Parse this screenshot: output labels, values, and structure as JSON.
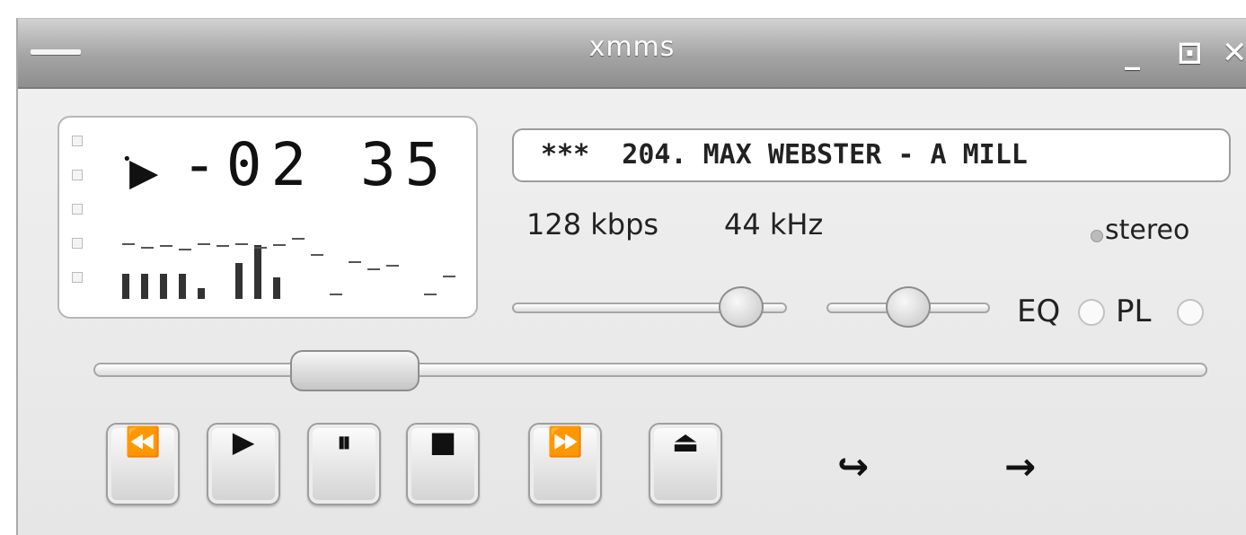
{
  "window": {
    "title": "xmms",
    "min_glyph": "_",
    "max_glyph": "⊡",
    "close_glyph": "✕"
  },
  "display": {
    "play_indicator": "▶",
    "play_dot": "•",
    "time": "-02 35",
    "status_squares": 5
  },
  "song": {
    "marquee": "***  204. MAX WEBSTER - A MILL"
  },
  "info": {
    "bitrate": "128 kbps",
    "samplerate": "44 kHz",
    "channel": "stereo"
  },
  "toggles": {
    "eq": "EQ",
    "pl": "PL"
  },
  "controls": {
    "prev": "⏪",
    "play": "▶",
    "pause": "⏸",
    "stop": "■",
    "next": "⏩",
    "eject": "⏏"
  },
  "options": {
    "repeat": "↪",
    "shuffle": "→"
  },
  "levels": {
    "volume": 0.9,
    "balance": 0.5,
    "seek": 0.2
  },
  "visualizer": {
    "bars": [
      0.35,
      0.35,
      0.35,
      0.35,
      0.15,
      0,
      0.5,
      0.75,
      0.3,
      0,
      0,
      0,
      0,
      0,
      0,
      0,
      0,
      0
    ],
    "peaks": [
      0.75,
      0.7,
      0.72,
      0.68,
      0.75,
      0.72,
      0.75,
      0.7,
      0.74,
      0.82,
      0.6,
      0.05,
      0.5,
      0.4,
      0.45,
      0,
      0.05,
      0.3
    ]
  },
  "colors": {
    "titlebar": "#9a9a9a",
    "background": "#ececec",
    "display_bg": "#ffffff"
  }
}
